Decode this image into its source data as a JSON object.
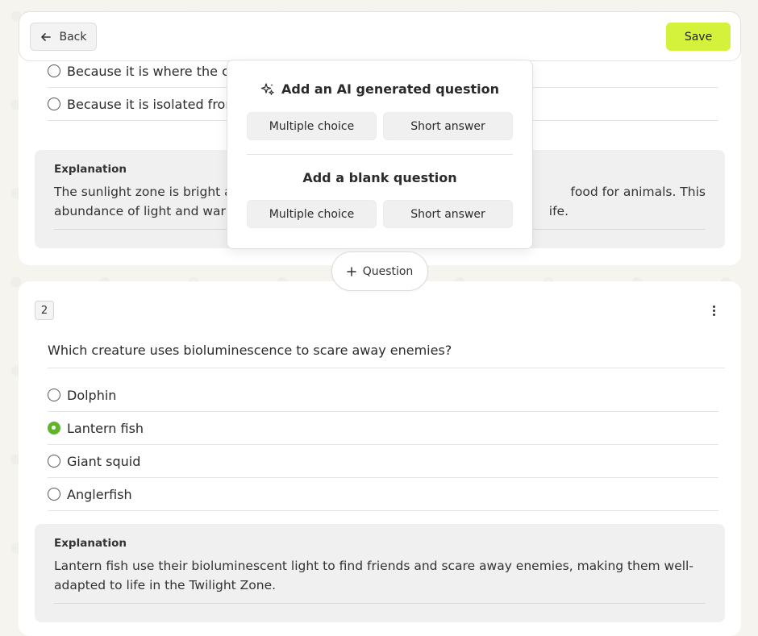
{
  "header": {
    "back_label": "Back",
    "save_label": "Save"
  },
  "question1": {
    "options": [
      {
        "text": "Because it is where the co",
        "selected": false
      },
      {
        "text": "Because it is isolated from",
        "selected": false
      }
    ],
    "explanation_label": "Explanation",
    "explanation_text_left": "The sunlight zone is bright a",
    "explanation_text_right": "food for animals. This",
    "explanation_text2_left": "abundance of light and warm",
    "explanation_text2_right": "ife."
  },
  "popover": {
    "ai_heading": "Add an AI generated question",
    "ai_multiple_choice": "Multiple choice",
    "ai_short_answer": "Short answer",
    "blank_heading": "Add a blank question",
    "blank_multiple_choice": "Multiple choice",
    "blank_short_answer": "Short answer"
  },
  "add_question_label": "Question",
  "question2": {
    "number": "2",
    "text": "Which creature uses bioluminescence to scare away enemies?",
    "options": [
      {
        "text": "Dolphin",
        "selected": false
      },
      {
        "text": "Lantern fish",
        "selected": true
      },
      {
        "text": "Giant squid",
        "selected": false
      },
      {
        "text": "Anglerfish",
        "selected": false
      }
    ],
    "explanation_label": "Explanation",
    "explanation_text": "Lantern fish use their bioluminescent light to find friends and scare away enemies, making them well-adapted to life in the Twilight Zone."
  },
  "colors": {
    "accent": "#d4f13b",
    "selected_radio": "#5fb528"
  }
}
